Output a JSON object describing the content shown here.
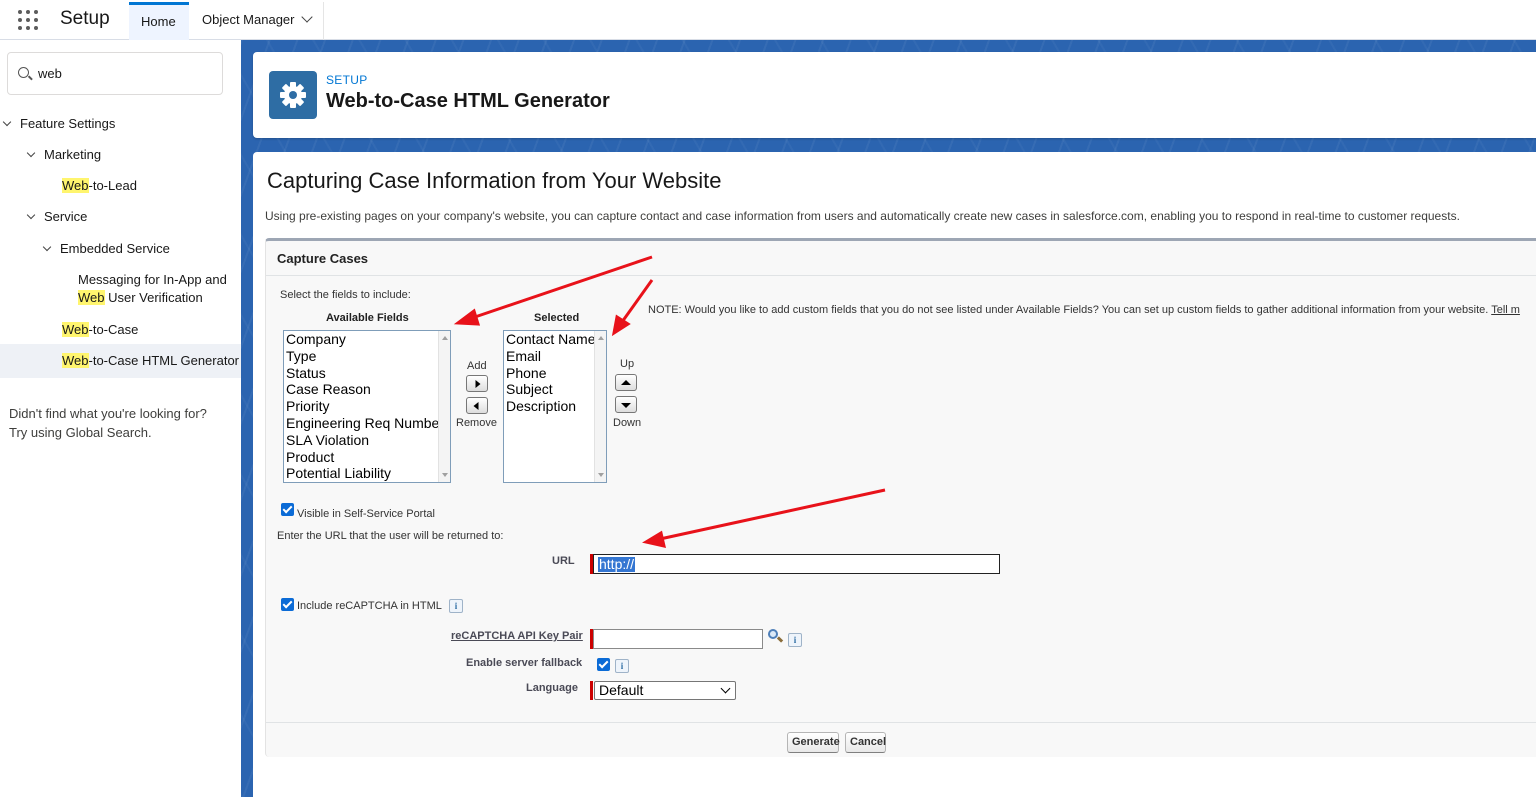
{
  "topbar": {
    "app_title": "Setup",
    "tabs": [
      {
        "label": "Home"
      },
      {
        "label": "Object Manager"
      }
    ]
  },
  "sidebar": {
    "search_value": "web",
    "nav": {
      "feature_settings": "Feature Settings",
      "marketing": "Marketing",
      "web_to_lead_hl": "Web",
      "web_to_lead_rest": "-to-Lead",
      "service": "Service",
      "embedded_service": "Embedded Service",
      "messaging_line1": "Messaging for In-App and",
      "messaging_hl": "Web",
      "messaging_rest": " User Verification",
      "web_to_case_hl": "Web",
      "web_to_case_rest": "-to-Case",
      "generator_hl": "Web",
      "generator_rest": "-to-Case HTML Generator"
    },
    "help_line1": "Didn't find what you're looking for?",
    "help_line2": "Try using Global Search."
  },
  "header": {
    "eyebrow": "SETUP",
    "title": "Web-to-Case HTML Generator"
  },
  "content": {
    "heading": "Capturing Case Information from Your Website",
    "intro": "Using pre-existing pages on your company's website, you can capture contact and case information from users and automatically create new cases in salesforce.com, enabling you to respond in real-time to customer requests.",
    "section_title": "Capture Cases",
    "select_prompt": "Select the fields to include:",
    "available_label": "Available Fields",
    "selected_label": "Selected",
    "available_fields": [
      "Company",
      "Type",
      "Status",
      "Case Reason",
      "Priority",
      "Engineering Req Number",
      "SLA Violation",
      "Product",
      "Potential Liability"
    ],
    "selected_fields": [
      "Contact Name",
      "Email",
      "Phone",
      "Subject",
      "Description"
    ],
    "add_label": "Add",
    "remove_label": "Remove",
    "up_label": "Up",
    "down_label": "Down",
    "note": "NOTE: Would you like to add custom fields that you do not see listed under Available Fields? You can set up custom fields to gather additional information from your website.",
    "note_link": "Tell m",
    "visible_portal_label": "Visible in Self-Service Portal",
    "return_url_prompt": "Enter the URL that the user will be returned to:",
    "url_label": "URL",
    "url_value": "http://",
    "recaptcha_label": "Include reCAPTCHA in HTML",
    "api_key_label": "reCAPTCHA API Key Pair",
    "server_fallback_label": "Enable server fallback",
    "language_label": "Language",
    "language_value": "Default",
    "info_glyph": "i",
    "generate_label": "Generate",
    "cancel_label": "Cancel"
  },
  "colors": {
    "brand_blue": "#0176d3",
    "annotation_red": "#e8121a",
    "highlight": "#fff56e"
  }
}
